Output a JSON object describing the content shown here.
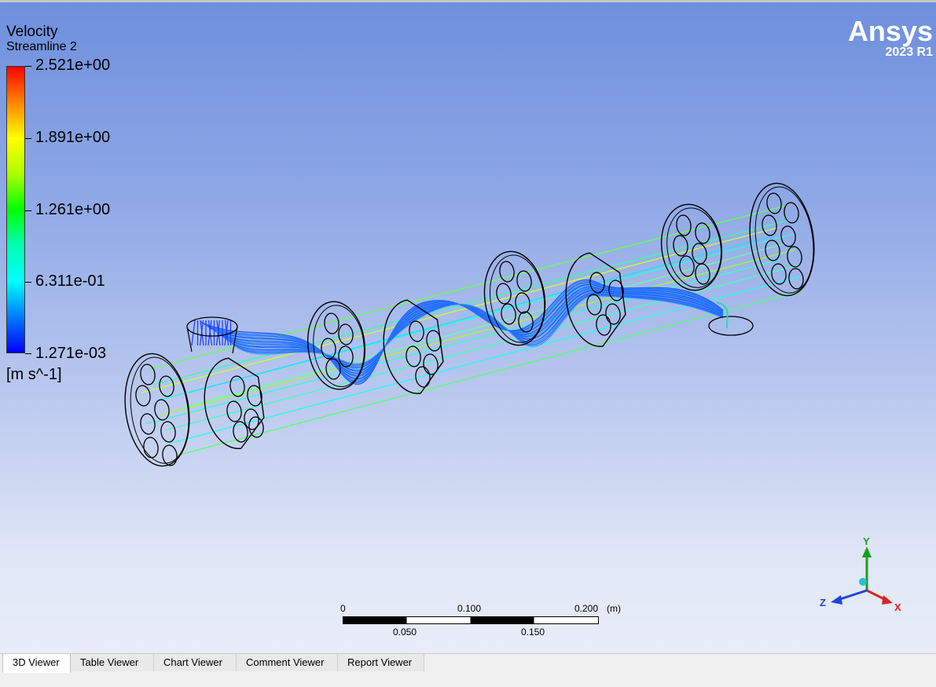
{
  "legend": {
    "title": "Velocity",
    "subtitle": "Streamline 2",
    "ticks": [
      "2.521e+00",
      "1.891e+00",
      "1.261e+00",
      "6.311e-01",
      "1.271e-03"
    ],
    "unit": "[m s^-1]",
    "colormap": [
      "#ff0000",
      "#ffff00",
      "#00ff00",
      "#00ffff",
      "#0000ff"
    ]
  },
  "brand": {
    "name": "Ansys",
    "version": "2023 R1"
  },
  "scale_bar": {
    "top_labels": [
      "0",
      "0.100",
      "0.200"
    ],
    "unit": "(m)",
    "bottom_labels": [
      "0.050",
      "0.150"
    ]
  },
  "axes": {
    "y": "Y",
    "z": "Z",
    "x": "X",
    "y_color": "#1a9e1a",
    "z_color": "#2244dd",
    "x_color": "#dd2222"
  },
  "tabs": [
    {
      "label": "3D Viewer",
      "active": true
    },
    {
      "label": "Table Viewer",
      "active": false
    },
    {
      "label": "Chart Viewer",
      "active": false
    },
    {
      "label": "Comment Viewer",
      "active": false
    },
    {
      "label": "Report Viewer",
      "active": false
    }
  ]
}
